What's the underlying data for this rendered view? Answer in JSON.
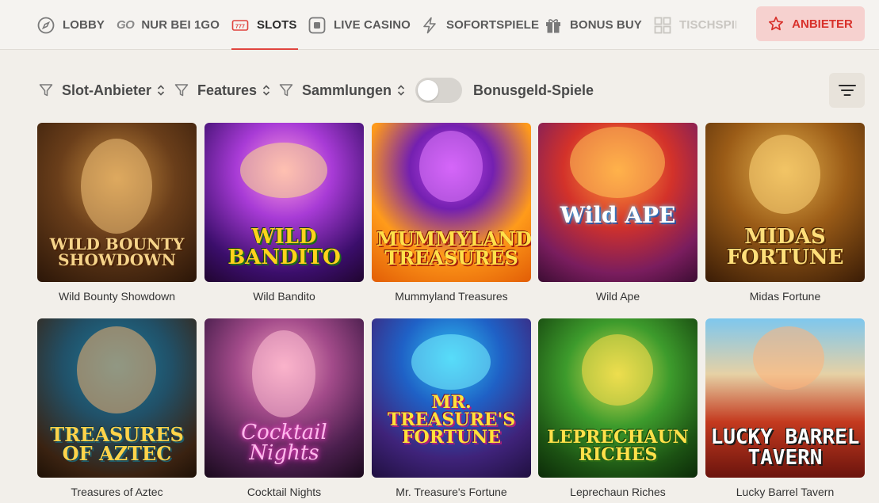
{
  "nav": {
    "items": [
      {
        "label": "LOBBY",
        "icon": "compass-icon"
      },
      {
        "label": "NUR BEI 1GO",
        "icon": "go-logo-icon",
        "prefix": "GO"
      },
      {
        "label": "SLOTS",
        "icon": "slot-machine-icon",
        "active": true
      },
      {
        "label": "LIVE CASINO",
        "icon": "live-casino-icon"
      },
      {
        "label": "SOFORTSPIELE",
        "icon": "lightning-icon"
      },
      {
        "label": "BONUS BUY",
        "icon": "gift-icon"
      },
      {
        "label": "TISCHSPIELE",
        "icon": "grid-icon",
        "faded": true
      }
    ],
    "provider_button": {
      "label": "ANBIETER",
      "icon": "star-icon"
    },
    "accent_color": "#e0453f"
  },
  "filters": {
    "slot_provider": "Slot-Anbieter",
    "features": "Features",
    "collections": "Sammlungen",
    "bonus_toggle_label": "Bonusgeld-Spiele",
    "bonus_toggle_on": false
  },
  "games": [
    {
      "name": "Wild Bounty Showdown",
      "logo": "WILD BOUNTY SHOWDOWN"
    },
    {
      "name": "Wild Bandito",
      "logo": "WILD BANDITO"
    },
    {
      "name": "Mummyland Treasures",
      "logo": "MUMMYLAND TREASURES"
    },
    {
      "name": "Wild Ape",
      "logo": "Wild APE"
    },
    {
      "name": "Midas Fortune",
      "logo": "MIDAS FORTUNE"
    },
    {
      "name": "Treasures of Aztec",
      "logo": "TREASURES OF AZTEC"
    },
    {
      "name": "Cocktail Nights",
      "logo": "Cocktail Nights"
    },
    {
      "name": "Mr. Treasure's Fortune",
      "logo": "MR. TREASURE'S FORTUNE"
    },
    {
      "name": "Leprechaun Riches",
      "logo": "LEPRECHAUN RICHES"
    },
    {
      "name": "Lucky Barrel Tavern",
      "logo": "LUCKY BARREL TAVERN"
    }
  ]
}
